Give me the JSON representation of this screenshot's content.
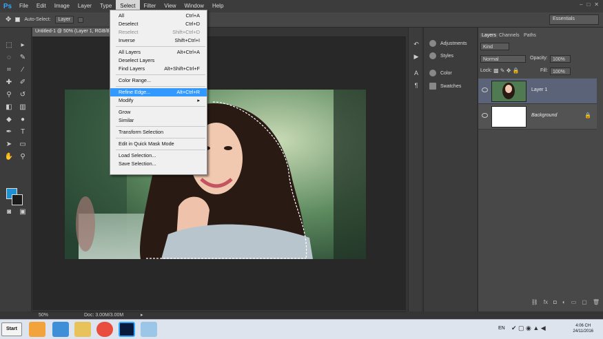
{
  "app": {
    "logo": "Ps"
  },
  "menubar": {
    "items": [
      "File",
      "Edit",
      "Image",
      "Layer",
      "Type",
      "Select",
      "Filter",
      "View",
      "Window",
      "Help"
    ],
    "active": "Select"
  },
  "window_controls": [
    "–",
    "□",
    "✕"
  ],
  "options_bar": {
    "autoselect_label": "Auto-Select:",
    "autoselect_value": "Layer",
    "workspace": "Essentials"
  },
  "document": {
    "tab_title": "Untitled-1 @ 50% (Layer 1, RGB/8)",
    "zoom": "50%",
    "doc_info": "Doc: 3.00M/3.00M"
  },
  "select_menu": [
    {
      "label": "All",
      "shortcut": "Ctrl+A",
      "enabled": true
    },
    {
      "label": "Deselect",
      "shortcut": "Ctrl+D",
      "enabled": true
    },
    {
      "label": "Reselect",
      "shortcut": "Shift+Ctrl+D",
      "enabled": false
    },
    {
      "label": "Inverse",
      "shortcut": "Shift+Ctrl+I",
      "enabled": true
    },
    {
      "sep": true
    },
    {
      "label": "All Layers",
      "shortcut": "Alt+Ctrl+A",
      "enabled": true
    },
    {
      "label": "Deselect Layers",
      "shortcut": "",
      "enabled": true
    },
    {
      "label": "Find Layers",
      "shortcut": "Alt+Shift+Ctrl+F",
      "enabled": true
    },
    {
      "sep": true
    },
    {
      "label": "Color Range...",
      "shortcut": "",
      "enabled": true
    },
    {
      "sep": true
    },
    {
      "label": "Refine Edge...",
      "shortcut": "Alt+Ctrl+R",
      "enabled": true,
      "highlight": true
    },
    {
      "label": "Modify",
      "shortcut": "▸",
      "enabled": true
    },
    {
      "sep": true
    },
    {
      "label": "Grow",
      "shortcut": "",
      "enabled": true
    },
    {
      "label": "Similar",
      "shortcut": "",
      "enabled": true
    },
    {
      "sep": true
    },
    {
      "label": "Transform Selection",
      "shortcut": "",
      "enabled": true
    },
    {
      "sep": true
    },
    {
      "label": "Edit in Quick Mask Mode",
      "shortcut": "",
      "enabled": true
    },
    {
      "sep": true
    },
    {
      "label": "Load Selection...",
      "shortcut": "",
      "enabled": true
    },
    {
      "label": "Save Selection...",
      "shortcut": "",
      "enabled": true
    }
  ],
  "mini_panels": [
    "Adjustments",
    "Styles",
    "Color",
    "Swatches"
  ],
  "layers_panel": {
    "tabs": [
      "Layers",
      "Channels",
      "Paths"
    ],
    "kind": "Kind",
    "blend_mode": "Normal",
    "opacity_label": "Opacity:",
    "opacity_value": "100%",
    "lock_label": "Lock:",
    "fill_label": "Fill:",
    "fill_value": "100%",
    "layers": [
      {
        "name": "Layer 1",
        "selected": true
      },
      {
        "name": "Background",
        "selected": false
      }
    ]
  },
  "taskbar": {
    "start": "Start",
    "lang": "EN",
    "time": "4:06 CH",
    "date": "24/11/2016"
  },
  "colors": {
    "foreground": "#1e8fd0",
    "background": "#1a1a1a",
    "highlight": "#3399ff"
  }
}
